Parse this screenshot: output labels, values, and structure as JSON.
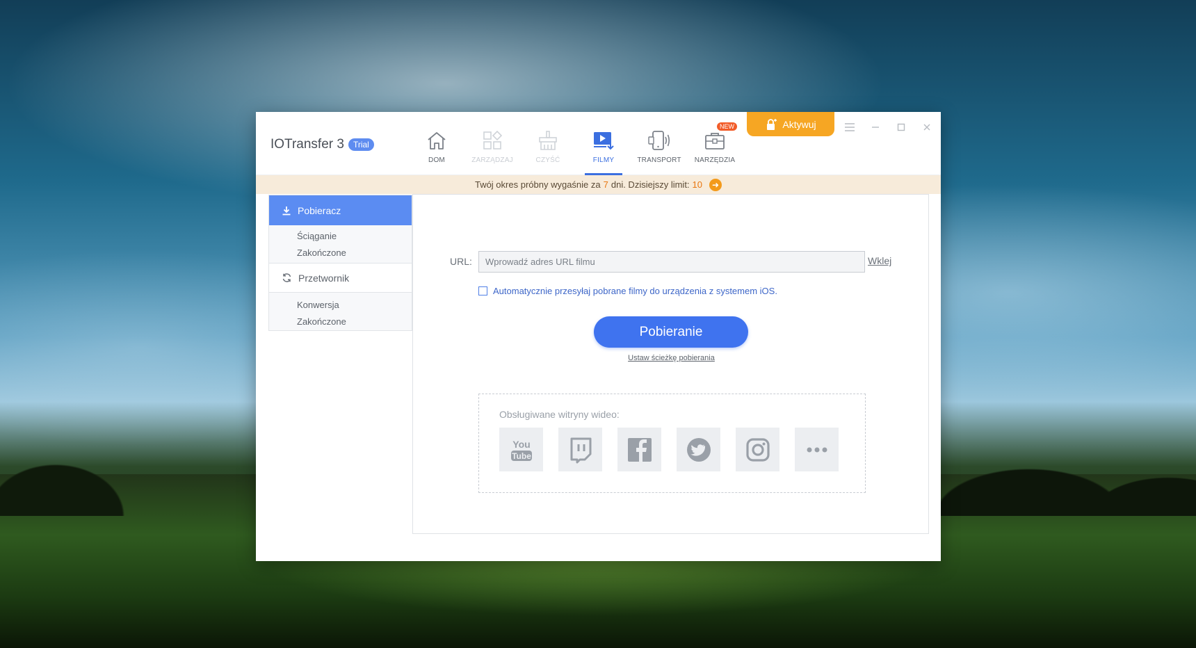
{
  "app": {
    "title": "IOTransfer 3",
    "badge": "Trial"
  },
  "nav": {
    "home": {
      "label": "DOM",
      "icon": "home-icon"
    },
    "manage": {
      "label": "ZARZĄDZAJ",
      "icon": "manage-icon"
    },
    "clean": {
      "label": "CZYŚĆ",
      "icon": "clean-icon"
    },
    "videos": {
      "label": "FILMY",
      "icon": "video-download-icon"
    },
    "transfer": {
      "label": "TRANSPORT",
      "icon": "phone-transfer-icon"
    },
    "tools": {
      "label": "NARZĘDZIA",
      "icon": "toolbox-icon",
      "badge": "NEW"
    }
  },
  "activate": {
    "label": "Aktywuj",
    "icon": "lock-icon"
  },
  "trial_bar": {
    "prefix": "Twój okres próbny wygaśnie za",
    "days": "7",
    "middle": "dni. Dzisiejszy limit:",
    "limit": "10"
  },
  "sidebar": {
    "downloader": {
      "label": "Pobieracz",
      "items": [
        "Ściąganie",
        "Zakończone"
      ]
    },
    "converter": {
      "label": "Przetwornik",
      "items": [
        "Konwersja",
        "Zakończone"
      ]
    }
  },
  "main": {
    "url_label": "URL:",
    "url_placeholder": "Wprowadź adres URL filmu",
    "url_value": "",
    "paste_label": "Wklej",
    "auto_transfer_label": "Automatycznie przesyłaj pobrane filmy do urządzenia z systemem iOS.",
    "download_button": "Pobieranie",
    "set_path_link": "Ustaw ścieżkę pobierania",
    "supported_title": "Obsługiwane witryny wideo:",
    "sites": [
      "YouTube",
      "Twitch",
      "Facebook",
      "Twitter",
      "Instagram",
      "More"
    ]
  },
  "colors": {
    "accent": "#3f73ef",
    "sidebar_active": "#5b8cf2",
    "activate": "#f6a623",
    "trial_bar_bg": "#f7ebda",
    "trial_highlight": "#e8760f",
    "new_badge": "#f25c29"
  }
}
